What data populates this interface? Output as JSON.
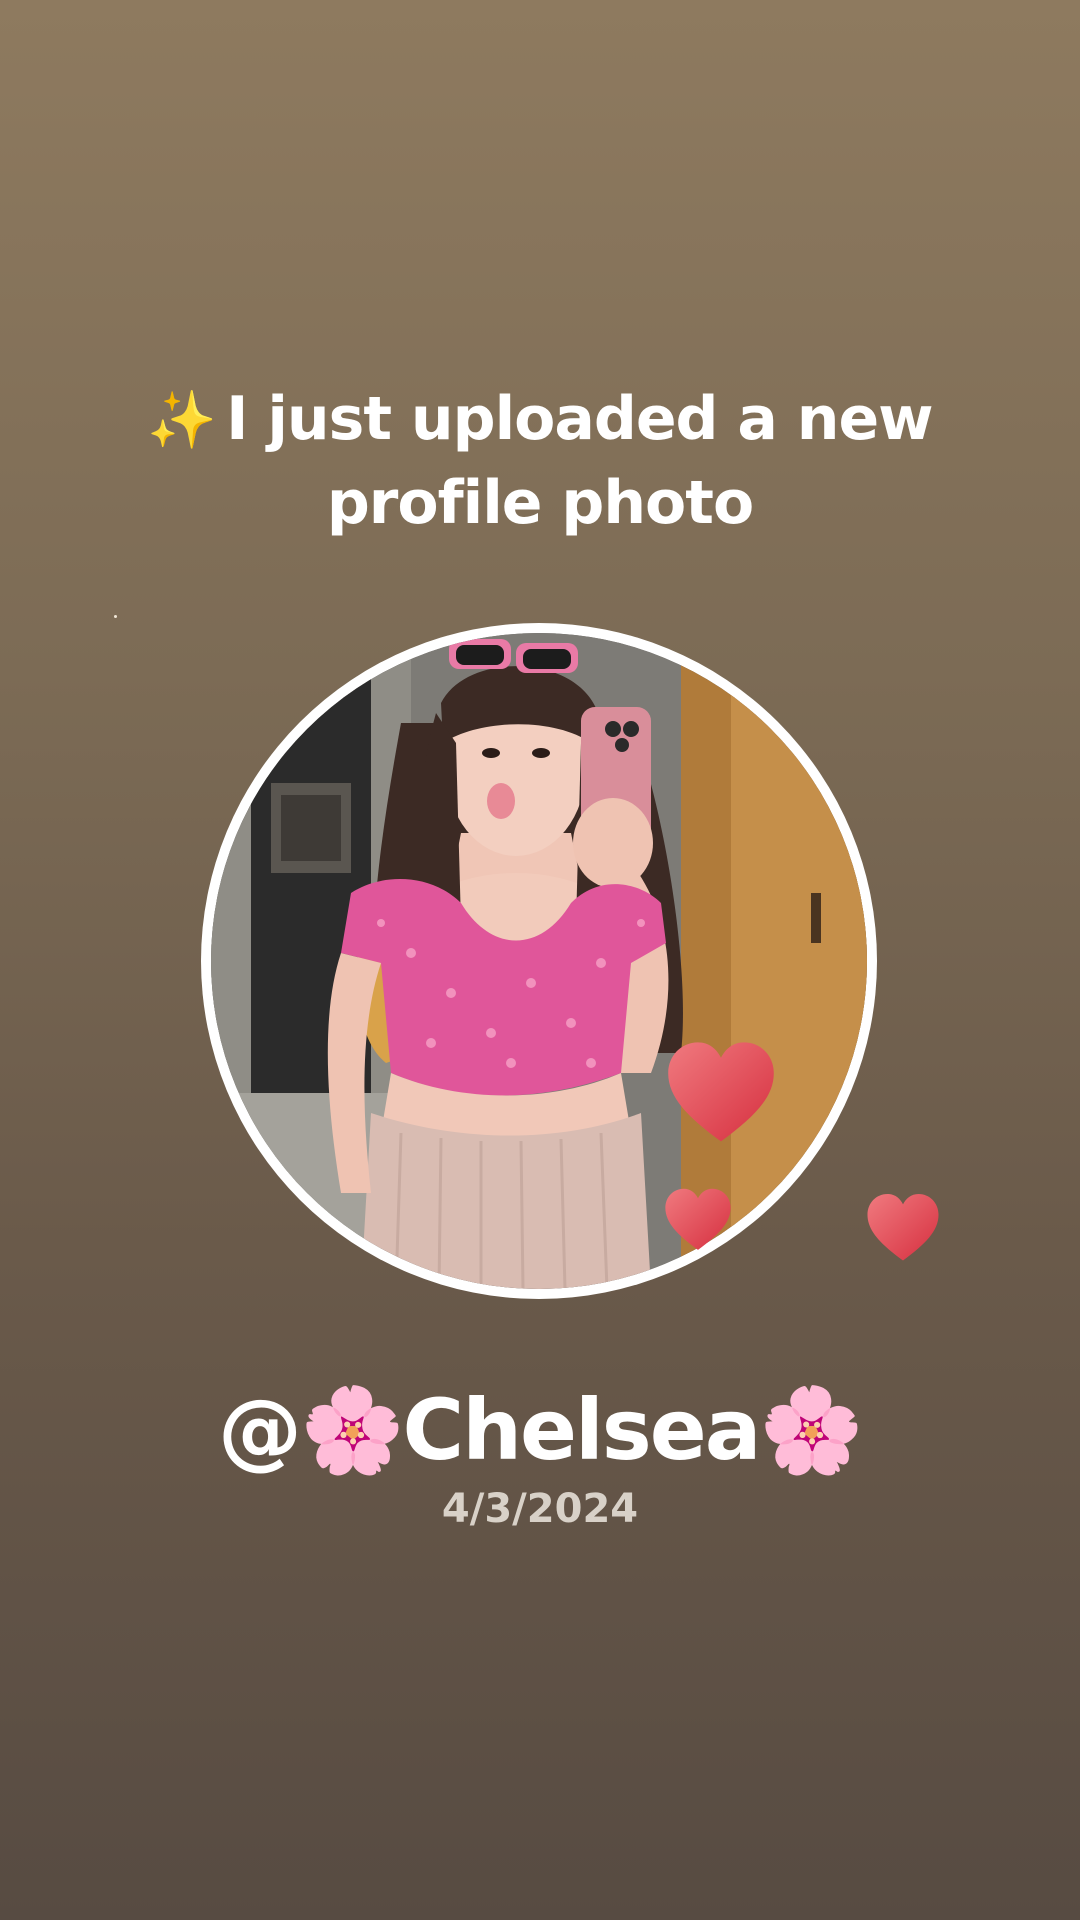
{
  "story": {
    "announcement_emoji": "✨",
    "announcement_text": "I just uploaded a new profile photo",
    "username": "@🌸Chelsea🌸",
    "date": "4/3/2024"
  },
  "icons": {
    "sparkles": "sparkles-icon",
    "hearts": [
      "heart-icon",
      "heart-icon",
      "heart-icon"
    ]
  },
  "colors": {
    "background_top": "#8e7a5f",
    "background_bottom": "#574b42",
    "text": "#ffffff",
    "date_text": "#d8d1c8",
    "heart": "#e0404c"
  }
}
